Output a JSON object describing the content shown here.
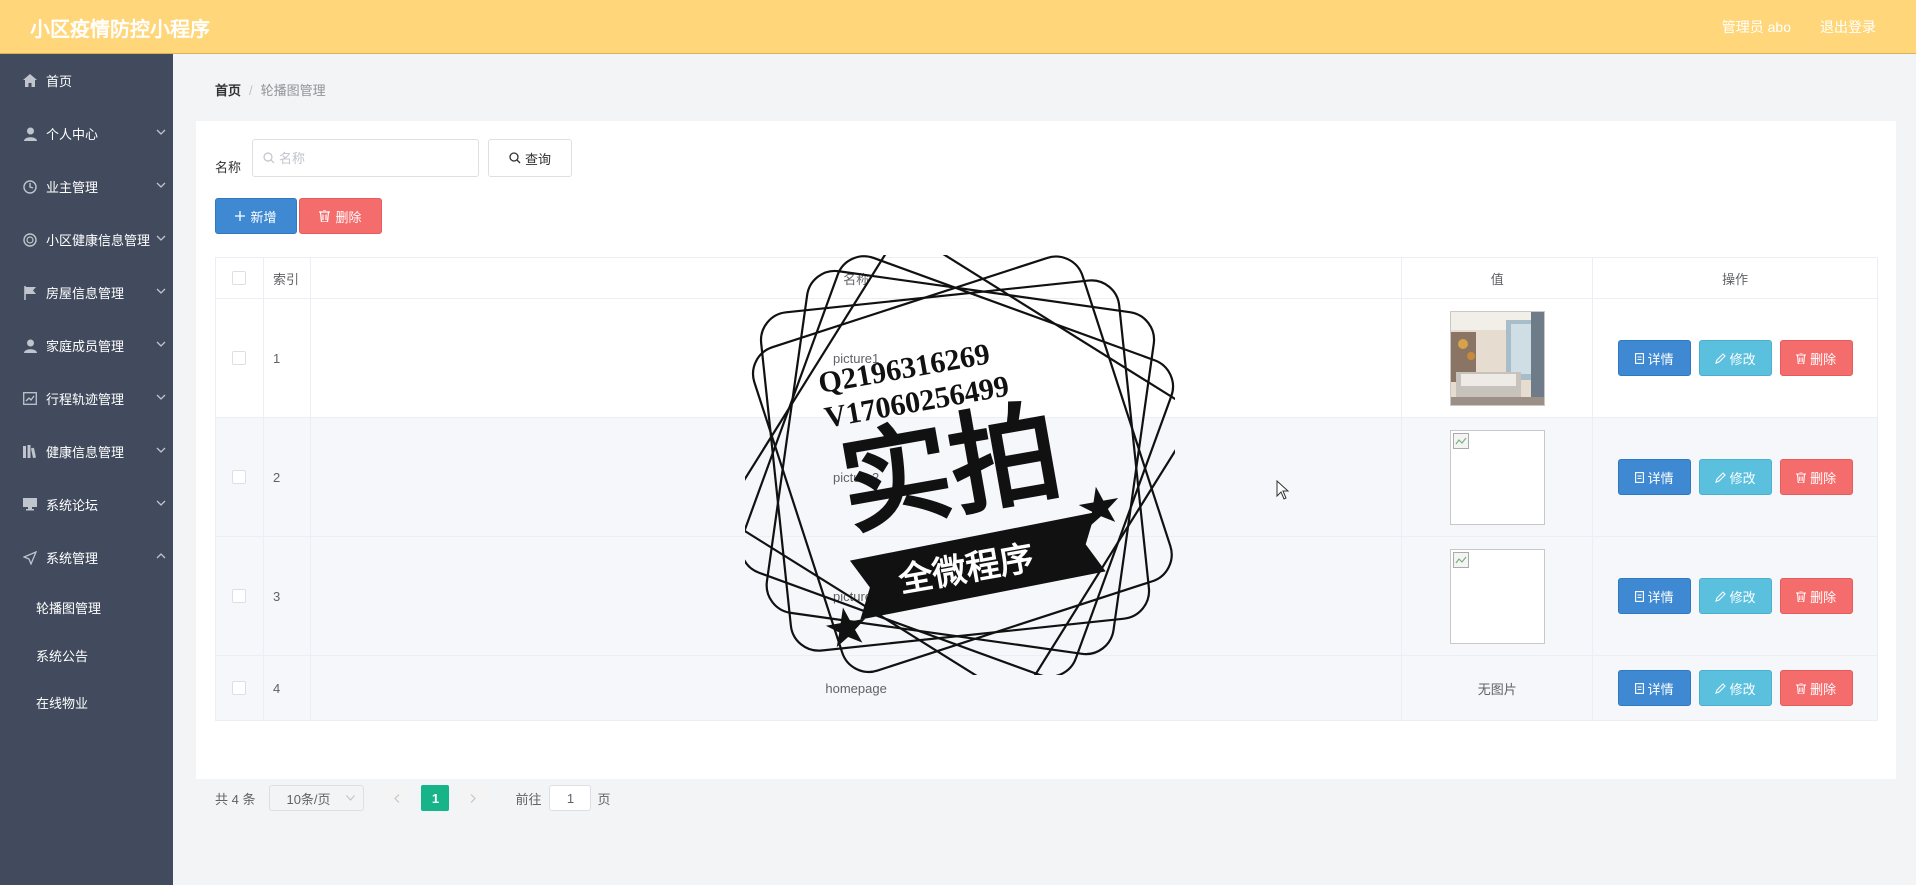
{
  "header": {
    "title": "小区疫情防控小程序",
    "user": "管理员 abo",
    "logout": "退出登录"
  },
  "sidebar": {
    "items": [
      {
        "label": "首页",
        "icon": "home-icon",
        "expandable": false
      },
      {
        "label": "个人中心",
        "icon": "user-icon",
        "expandable": true
      },
      {
        "label": "业主管理",
        "icon": "clock-icon",
        "expandable": true
      },
      {
        "label": "小区健康信息管理",
        "icon": "circle-icon",
        "expandable": true
      },
      {
        "label": "房屋信息管理",
        "icon": "flag-icon",
        "expandable": true
      },
      {
        "label": "家庭成员管理",
        "icon": "user-icon",
        "expandable": true
      },
      {
        "label": "行程轨迹管理",
        "icon": "chart-icon",
        "expandable": true
      },
      {
        "label": "健康信息管理",
        "icon": "bars-icon",
        "expandable": true
      },
      {
        "label": "系统论坛",
        "icon": "monitor-icon",
        "expandable": true
      },
      {
        "label": "系统管理",
        "icon": "send-icon",
        "expandable": true,
        "expanded": true
      }
    ],
    "submenu": [
      {
        "label": "轮播图管理"
      },
      {
        "label": "系统公告"
      },
      {
        "label": "在线物业"
      }
    ]
  },
  "breadcrumb": {
    "home": "首页",
    "separator": "/",
    "current": "轮播图管理"
  },
  "search": {
    "label": "名称",
    "placeholder": "名称",
    "value": "",
    "query_label": "查询"
  },
  "actions": {
    "add_label": "新增",
    "delete_label": "删除"
  },
  "table": {
    "columns": {
      "index": "索引",
      "name": "名称",
      "value": "值",
      "ops": "操作"
    },
    "rows": [
      {
        "index": "1",
        "name": "picture1",
        "image": "photo"
      },
      {
        "index": "2",
        "name": "picture2",
        "image": "broken"
      },
      {
        "index": "3",
        "name": "picture3",
        "image": "broken"
      },
      {
        "index": "4",
        "name": "homepage",
        "image": "none",
        "value_text": "无图片"
      }
    ],
    "op_labels": {
      "detail": "详情",
      "edit": "修改",
      "delete": "删除"
    }
  },
  "pagination": {
    "total": "共 4 条",
    "page_size": "10条/页",
    "current_page": "1",
    "goto_label": "前往",
    "goto_value": "1",
    "page_suffix": "页"
  },
  "watermark": {
    "line1": "Q2196316269",
    "line2": "V17060256499",
    "main": "实拍",
    "banner": "全微程序"
  },
  "colors": {
    "header": "#ffd77a",
    "sidebar": "#424b5d",
    "primary": "#3e89d2",
    "danger": "#f56c6c",
    "info": "#5bc0de",
    "pager_active": "#17b48a"
  }
}
